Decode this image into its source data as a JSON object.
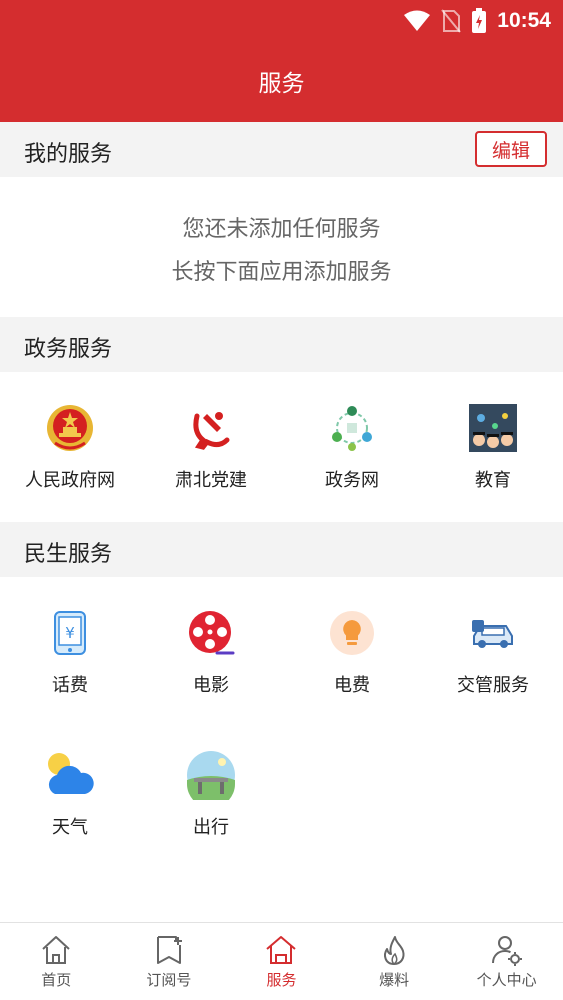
{
  "status_bar": {
    "time": "10:54",
    "icons": [
      "wifi-icon",
      "no-sim-icon",
      "battery-charging-icon"
    ]
  },
  "header": {
    "title": "服务"
  },
  "my_services": {
    "title": "我的服务",
    "edit_label": "编辑",
    "empty_line1": "您还未添加任何服务",
    "empty_line2": "长按下面应用添加服务"
  },
  "gov_services": {
    "title": "政务服务",
    "items": [
      {
        "label": "人民政府网",
        "icon": "national-emblem-icon"
      },
      {
        "label": "肃北党建",
        "icon": "party-emblem-icon"
      },
      {
        "label": "政务网",
        "icon": "gov-network-icon"
      },
      {
        "label": "教育",
        "icon": "education-icon"
      }
    ]
  },
  "life_services": {
    "title": "民生服务",
    "items": [
      {
        "label": "话费",
        "icon": "phone-bill-icon"
      },
      {
        "label": "电影",
        "icon": "film-reel-icon"
      },
      {
        "label": "电费",
        "icon": "lightbulb-icon"
      },
      {
        "label": "交管服务",
        "icon": "traffic-car-icon"
      },
      {
        "label": "天气",
        "icon": "weather-icon"
      },
      {
        "label": "出行",
        "icon": "travel-icon"
      }
    ]
  },
  "bottom_nav": {
    "active_index": 2,
    "items": [
      {
        "label": "首页",
        "icon": "home-icon"
      },
      {
        "label": "订阅号",
        "icon": "subscribe-icon"
      },
      {
        "label": "服务",
        "icon": "service-house-icon"
      },
      {
        "label": "爆料",
        "icon": "flame-icon"
      },
      {
        "label": "个人中心",
        "icon": "user-settings-icon"
      }
    ]
  },
  "colors": {
    "brand_red": "#d42d2f",
    "section_bg": "#f3f3f3"
  }
}
